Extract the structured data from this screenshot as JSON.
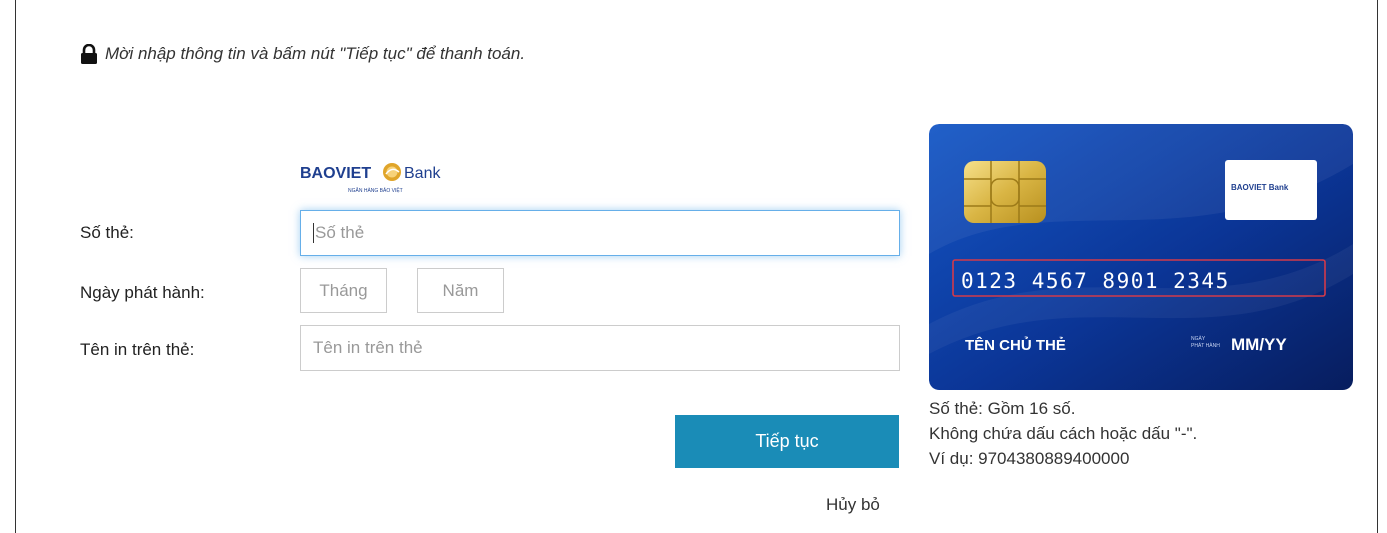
{
  "notice": {
    "text": "Mời nhập thông tin và bấm nút \"Tiếp tục\" để thanh toán."
  },
  "bank": {
    "name_part1": "BAOVIET",
    "name_part2": "Bank",
    "subtitle": "NGÂN HÀNG BẢO VIỆT"
  },
  "form": {
    "card_number": {
      "label": "Số thẻ:",
      "placeholder": "Số thẻ",
      "value": ""
    },
    "issue_date": {
      "label": "Ngày phát hành:",
      "month_placeholder": "Tháng",
      "year_placeholder": "Năm"
    },
    "cardholder": {
      "label": "Tên in trên thẻ:",
      "placeholder": "Tên in trên thẻ",
      "value": ""
    },
    "submit_label": "Tiếp tục",
    "cancel_label": "Hủy bỏ"
  },
  "card_preview": {
    "number": "0123 4567 8901 2345",
    "holder": "TÊN CHỦ THẺ",
    "date_caption_line1": "NGÀY",
    "date_caption_line2": "PHÁT HÀNH",
    "date": "MM/YY",
    "logo_text": "BAOVIET Bank"
  },
  "hint": {
    "line1": "Số thẻ: Gồm 16 số.",
    "line2": "Không chứa dấu cách hoặc dấu \"-\".",
    "line3": "Ví dụ: 9704380889400000"
  },
  "colors": {
    "accent": "#1a8cb7",
    "card_bg": "#0d2f8c",
    "focus_border": "#66afe9"
  }
}
